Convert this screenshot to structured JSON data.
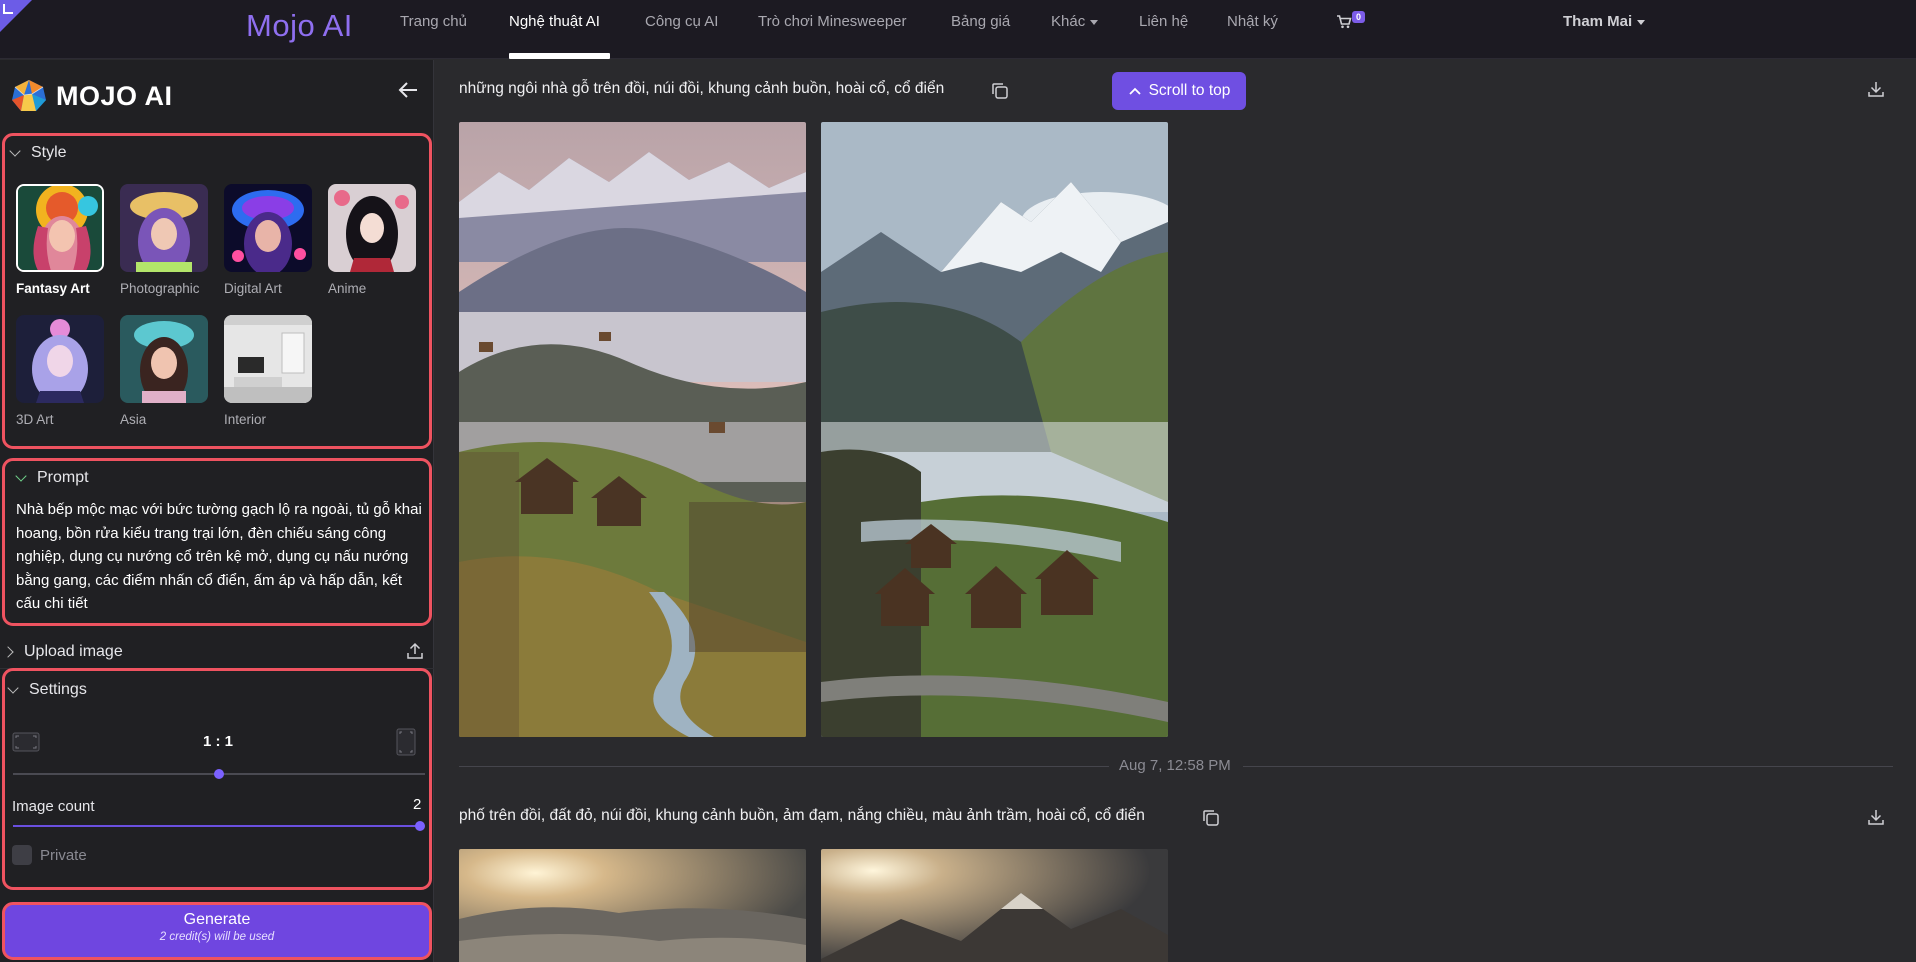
{
  "nav": {
    "brand": "Mojo AI",
    "items": [
      "Trang chủ",
      "Nghệ thuật AI",
      "Công cụ AI",
      "Trò chơi Minesweeper",
      "Bảng giá",
      "Khác",
      "Liên hệ",
      "Nhật ký"
    ],
    "active_index": 1,
    "cart_count": "0",
    "user": "Tham Mai"
  },
  "sidebar": {
    "logo_text": "MOJO AI",
    "style": {
      "title": "Style",
      "items": [
        {
          "label": "Fantasy Art",
          "selected": true
        },
        {
          "label": "Photographic",
          "selected": false
        },
        {
          "label": "Digital Art",
          "selected": false
        },
        {
          "label": "Anime",
          "selected": false
        },
        {
          "label": "3D Art",
          "selected": false
        },
        {
          "label": "Asia",
          "selected": false
        },
        {
          "label": "Interior",
          "selected": false
        }
      ]
    },
    "prompt": {
      "title": "Prompt",
      "text": "Nhà bếp mộc mạc với bức tường gạch lộ ra ngoài, tủ gỗ khai hoang, bồn rửa kiểu trang trại lớn, đèn chiếu sáng công nghiệp, dụng cụ nướng cổ trên kệ mở, dụng cụ nấu nướng bằng gang, các điểm nhấn cổ điển, ấm áp và hấp dẫn, kết cấu chi tiết"
    },
    "upload": {
      "title": "Upload image"
    },
    "settings": {
      "title": "Settings",
      "ratio": "1 : 1",
      "ratio_slider_fraction": 0.5,
      "image_count_label": "Image count",
      "image_count": "2",
      "image_count_fraction": 1.0,
      "private_label": "Private",
      "private_checked": false
    },
    "generate": {
      "label": "Generate",
      "sub": "2 credit(s) will be used"
    }
  },
  "main": {
    "scroll_to_top": "Scroll to top",
    "groups": [
      {
        "prompt": "những ngôi nhà gỗ trên đồi, núi đồi, khung cảnh buồn, hoài cổ, cổ điển",
        "image_count": 2
      },
      {
        "timestamp": "Aug 7, 12:58 PM",
        "prompt": "phố trên đồi, đất đỏ, núi đồi, khung cảnh buồn, ảm đạm, nắng chiều, màu ảnh trầm, hoài cổ, cổ điển",
        "image_count": 2
      }
    ]
  },
  "colors": {
    "accent": "#6f4fe2",
    "highlight_border": "#ef5360",
    "nav_bg": "#1c1a22",
    "sidebar_bg": "#202023",
    "main_bg": "#2a2a2d"
  },
  "icons": [
    "arrow-left-icon",
    "chevron-down-icon",
    "chevron-right-icon",
    "upload-icon",
    "copy-icon",
    "download-icon",
    "cart-icon",
    "landscape-ratio-icon",
    "portrait-ratio-icon",
    "chevron-up-icon"
  ]
}
